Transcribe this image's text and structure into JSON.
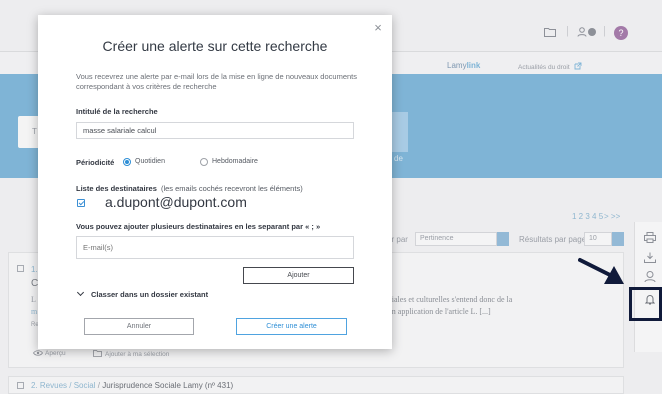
{
  "header": {
    "lamylink_prefix": "Lamy",
    "lamylink_suffix": "link",
    "news_link": "Actualités du droit",
    "help_label": "?"
  },
  "banner": {
    "search_prefix": "T",
    "side_text": "de"
  },
  "results": {
    "pagination": "1 2 3 4 5",
    "pagination_next": "> >>",
    "sort_label": "Trier par",
    "sort_value": "Pertinence",
    "per_page_label": "Résultats par page",
    "per_page_value": "10"
  },
  "result_1": {
    "number": "1.",
    "title_fragment": "C",
    "fragment_l": "L",
    "fragment_m": "m",
    "fragment_re": "Re",
    "excerpt_1": "vités sociales et culturelles s'entend donc de la",
    "excerpt_2": "sociale en application de l'article L. [...]",
    "preview_label": "Aperçu",
    "add_selection_label": "Ajouter à ma sélection"
  },
  "result_2": {
    "number": "2.",
    "breadcrumb": "Revues / Social",
    "title": "Jurisprudence Sociale Lamy (nº 431)"
  },
  "modal": {
    "title": "Créer une alerte sur cette recherche",
    "close_label": "×",
    "intro": "Vous recevrez une alerte par e-mail lors de la mise en ligne de nouveaux documents correspondant à vos critères de recherche",
    "search_name_label": "Intitulé de la recherche",
    "search_name_value": "masse salariale calcul",
    "periodicity_label": "Périodicité",
    "periodicity_options": [
      "Quotidien",
      "Hebdomadaire"
    ],
    "periodicity_selected": "Quotidien",
    "recipients_label": "Liste des destinataires",
    "recipients_hint": "(les emails cochés recevront les éléments)",
    "recipient_email": "a.dupont@dupont.com",
    "add_more_label": "Vous pouvez ajouter plusieurs destinataires en les separant par « ; »",
    "email_placeholder": "E-mail(s)",
    "add_button": "Ajouter",
    "folder_toggle": "Classer dans un dossier existant",
    "cancel_button": "Annuler",
    "create_button": "Créer une alerte"
  },
  "colors": {
    "banner": "#7fb4d6",
    "accent": "#2f8fd6",
    "annotation": "#101a3a",
    "help": "#a37aa8"
  },
  "icons": {
    "folder": "folder-icon",
    "user": "user-icon",
    "help": "help-icon",
    "print": "print-icon",
    "download": "download-icon",
    "search_person": "person-search-icon",
    "bell": "bell-icon",
    "eye": "eye-icon",
    "external": "external-link-icon"
  }
}
